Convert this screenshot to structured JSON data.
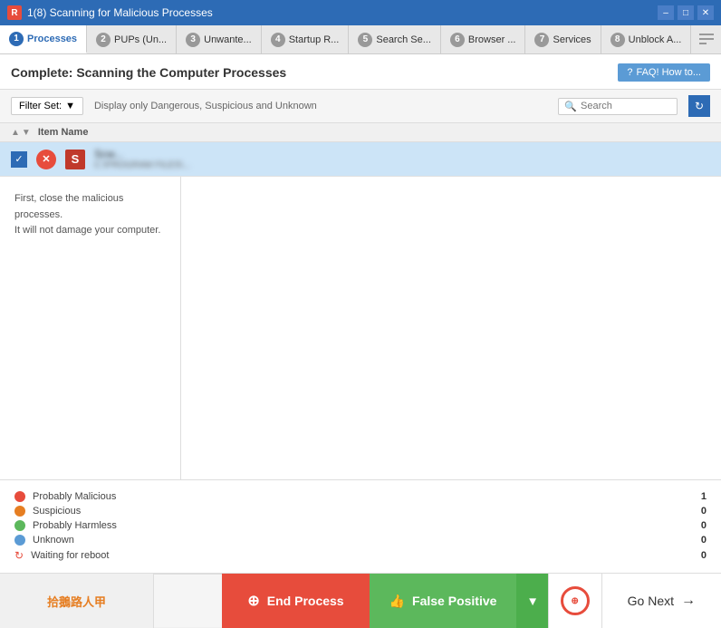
{
  "titleBar": {
    "icon": "R",
    "title": "1(8) Scanning for Malicious Processes",
    "minimize": "–",
    "maximize": "□",
    "close": "✕"
  },
  "tabs": [
    {
      "id": 1,
      "label": "Processes",
      "active": true
    },
    {
      "id": 2,
      "label": "PUPs (Un...",
      "active": false
    },
    {
      "id": 3,
      "label": "Unwante...",
      "active": false
    },
    {
      "id": 4,
      "label": "Startup R...",
      "active": false
    },
    {
      "id": 5,
      "label": "Search Se...",
      "active": false
    },
    {
      "id": 6,
      "label": "Browser ...",
      "active": false
    },
    {
      "id": 7,
      "label": "Services",
      "active": false
    },
    {
      "id": 8,
      "label": "Unblock A...",
      "active": false
    }
  ],
  "header": {
    "title": "Complete: Scanning the Computer Processes",
    "faqLabel": "FAQ! How to..."
  },
  "filterBar": {
    "filterSetLabel": "Filter Set:",
    "filterDescription": "Display only Dangerous, Suspicious and Unknown",
    "searchPlaceholder": "Search"
  },
  "tableHeader": {
    "itemNameLabel": "Item Name"
  },
  "tableRow": {
    "nameBlurred": "Scw...",
    "pathBlurred": "C:\\PROGRAM FILES\\...",
    "threatLevel": "!"
  },
  "leftPanel": {
    "line1": "First, close the malicious",
    "line2": "processes.",
    "line3": "It will not damage your computer."
  },
  "summary": [
    {
      "label": "Probably Malicious",
      "count": "1",
      "color": "#e74c3c"
    },
    {
      "label": "Suspicious",
      "count": "0",
      "color": "#e67e22"
    },
    {
      "label": "Probably Harmless",
      "count": "0",
      "color": "#5cb85c"
    },
    {
      "label": "Unknown",
      "count": "0",
      "color": "#5b9bd5"
    },
    {
      "label": "Waiting for reboot",
      "count": "0",
      "color": "#e74c3c"
    }
  ],
  "bottomBar": {
    "logoText1": "拾鵝路人甲",
    "endProcessLabel": "End Process",
    "falsePositiveLabel": "False Positive",
    "goNextLabel": "Go Next",
    "crosshairIcon": "⊕"
  }
}
